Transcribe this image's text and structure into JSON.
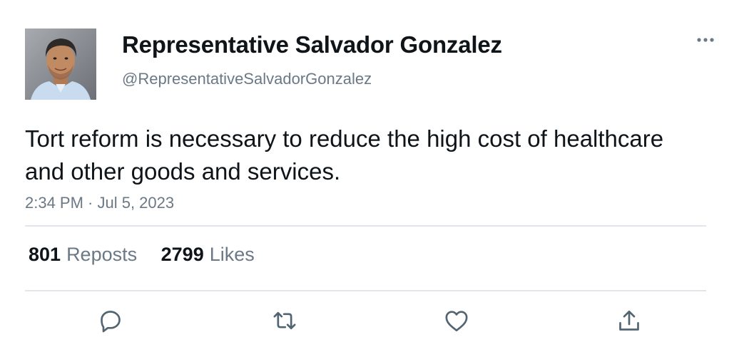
{
  "author": {
    "display_name": "Representative Salvador Gonzalez",
    "handle": "@RepresentativeSalvadorGonzalez",
    "avatar_icon": "profile-photo"
  },
  "tweet": {
    "text": "Tort reform is necessary to reduce the high cost of healthcare and other goods and services.",
    "timestamp": "2:34 PM · Jul 5, 2023"
  },
  "stats": {
    "reposts_count": "801",
    "reposts_label": "Reposts",
    "likes_count": "2799",
    "likes_label": "Likes"
  },
  "actions": [
    {
      "icon": "reply-icon"
    },
    {
      "icon": "repost-icon"
    },
    {
      "icon": "like-icon"
    },
    {
      "icon": "share-icon"
    }
  ],
  "colors": {
    "text_primary": "#0f1419",
    "text_secondary": "#6b7886",
    "divider": "#e1e5e9",
    "icon": "#536471"
  }
}
